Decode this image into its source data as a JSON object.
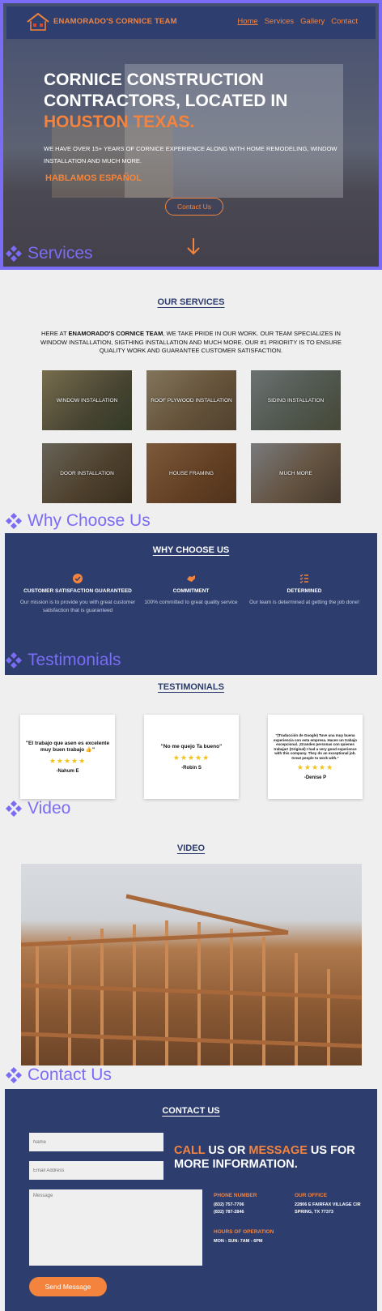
{
  "colors": {
    "navy": "#2c3d6e",
    "accent": "#f4843d",
    "label": "#7b6cf6"
  },
  "nav": {
    "brand": "ENAMORADO'S CORNICE TEAM",
    "items": [
      {
        "label": "Home",
        "active": true
      },
      {
        "label": "Services"
      },
      {
        "label": "Gallery"
      },
      {
        "label": "Contact"
      }
    ]
  },
  "hero": {
    "title_line1": "CORNICE CONSTRUCTION",
    "title_line2": "CONTRACTORS, LOCATED IN",
    "title_highlight": "HOUSTON TEXAS.",
    "subtitle": "WE HAVE OVER 15+ YEARS OF CORNICE EXPERIENCE ALONG WITH HOME REMODELING, WINDOW INSTALLATION AND MUCH MORE.",
    "hablamos": "HABLAMOS ESPAÑOL",
    "cta": "Contact Us"
  },
  "section_labels": {
    "services": "Services",
    "why": "Why Choose Us",
    "testimonials": "Testimonials",
    "video": "Video",
    "contact": "Contact Us"
  },
  "services": {
    "heading": "OUR SERVICES",
    "intro_pre": "HERE AT ",
    "intro_bold": "ENAMORADO'S CORNICE TEAM",
    "intro_post": ", WE TAKE PRIDE IN OUR WORK. OUR TEAM SPECIALIZES IN WINDOW INSTALLATION, SIGTHING INSTALLATION AND MUCH MORE. OUR #1 PRIORITY IS TO ENSURE QUALITY WORK AND GUARANTEE CUSTOMER SATISFACTION.",
    "tiles": [
      "WINDOW INSTALLATION",
      "ROOF PLYWOOD INSTALLATION",
      "SIDING INSTALLATION",
      "DOOR INSTALLATION",
      "HOUSE FRAMING",
      "MUCH MORE"
    ]
  },
  "why": {
    "heading": "WHY CHOOSE US",
    "features": [
      {
        "icon": "check-circle-icon",
        "title": "CUSTOMER SATISFACTION GUARANTEED",
        "desc": "Our mission is to provide you with great customer satisfaction that is guaranteed"
      },
      {
        "icon": "handshake-icon",
        "title": "COMMITMENT",
        "desc": "100% committed to great quality service"
      },
      {
        "icon": "list-check-icon",
        "title": "DETERMINED",
        "desc": "Our team is determined at getting the job done!"
      }
    ]
  },
  "testimonials": {
    "heading": "TESTIMONIALS",
    "items": [
      {
        "quote": "\"El trabajo que asen es excelente muy buen trabajo 👍\"",
        "stars": "★★★★★",
        "name": "-Nahum E"
      },
      {
        "quote": "\"No me quejo Ta bueno\"",
        "stars": "★★★★★",
        "name": "-Robin S"
      },
      {
        "quote": "\"(Traducción de Google) Tuve una muy buena experiencia con esta empresa. Hacen un trabajo excepcional. ¡Grandes personas con quienes trabajar! (Original) I had a very good experience with this company. They do an exceptional job. Great people to work with.\"",
        "stars": "★★★★★",
        "name": "-Denise P"
      }
    ]
  },
  "video": {
    "heading": "VIDEO"
  },
  "contact": {
    "heading": "CONTACT US",
    "placeholders": {
      "name": "Name",
      "email": "Email Address",
      "message": "Message"
    },
    "send": "Send Message",
    "title_call": "CALL",
    "title_us_or": " US OR ",
    "title_message": "MESSAGE",
    "title_rest": " US FOR MORE INFORMATION.",
    "phone_h": "PHONE NUMBER",
    "phone_1": "(832) 757-7706",
    "phone_2": "(832) 787-2846",
    "office_h": "OUR OFFICE",
    "office_1": "22806 E FAIRFAX VILLAGE CIR",
    "office_2": "SPRING, TX 77373",
    "hours_h": "HOURS OF OPERATION",
    "hours_v": "MON - SUN: 7AM - 6PM"
  }
}
